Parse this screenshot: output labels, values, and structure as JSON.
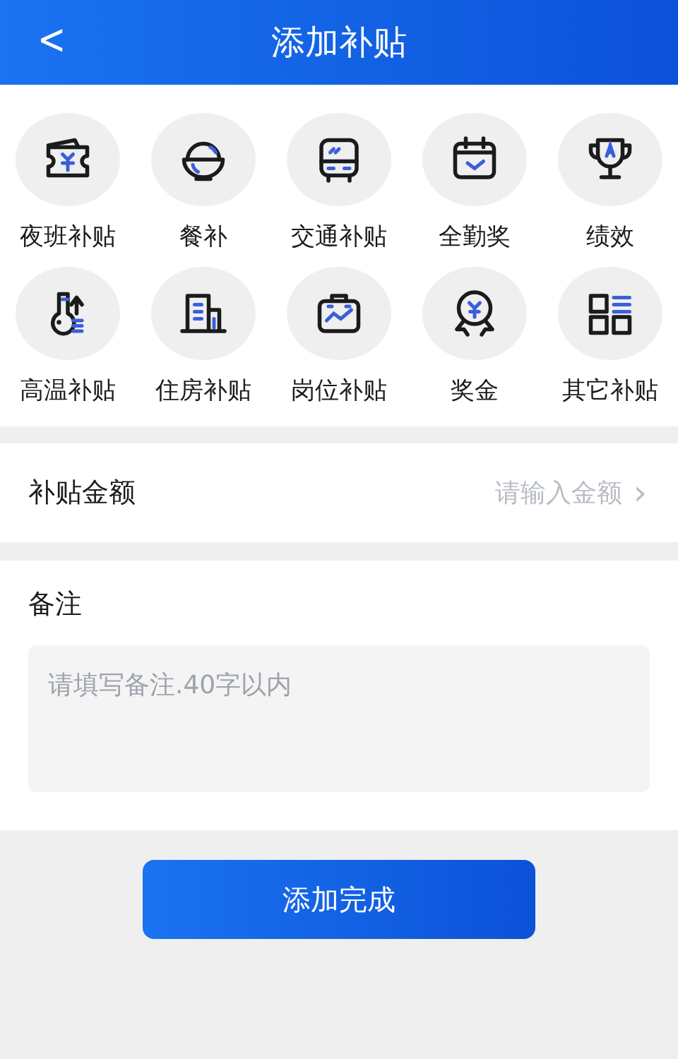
{
  "header": {
    "back_icon": "<",
    "title": "添加补贴"
  },
  "allowance_types": [
    {
      "label": "夜班补贴"
    },
    {
      "label": "餐补"
    },
    {
      "label": "交通补贴"
    },
    {
      "label": "全勤奖"
    },
    {
      "label": "绩效"
    },
    {
      "label": "高温补贴"
    },
    {
      "label": "住房补贴"
    },
    {
      "label": "岗位补贴"
    },
    {
      "label": "奖金"
    },
    {
      "label": "其它补贴"
    }
  ],
  "amount": {
    "label": "补贴金额",
    "placeholder": "请输入金额",
    "chevron": "›"
  },
  "remark": {
    "label": "备注",
    "placeholder": "请填写备注.40字以内"
  },
  "submit_button": "添加完成"
}
